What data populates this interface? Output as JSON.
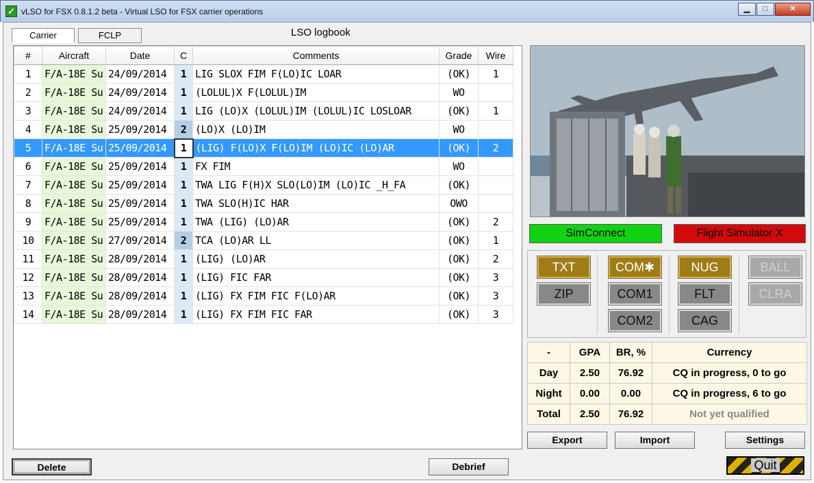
{
  "window": {
    "title": "vLSO for FSX 0.8.1.2 beta - Virtual LSO for FSX carrier operations",
    "min": "▁",
    "max": "□",
    "close": "✕"
  },
  "tabs": [
    {
      "label": "Carrier"
    },
    {
      "label": "FCLP"
    }
  ],
  "logbook_title": "LSO logbook",
  "grid": {
    "headers": {
      "num": "#",
      "aircraft": "Aircraft",
      "date": "Date",
      "c": "C",
      "comments": "Comments",
      "grade": "Grade",
      "wire": "Wire"
    },
    "rows": [
      {
        "num": "1",
        "aircraft": "F/A-18E Su",
        "date": "24/09/2014",
        "c": "1",
        "comments": "LIG SLOX FIM F(LO)IC LOAR",
        "grade": "(OK)",
        "wire": "1"
      },
      {
        "num": "2",
        "aircraft": "F/A-18E Su",
        "date": "24/09/2014",
        "c": "1",
        "comments": "(LOLUL)X F(LOLUL)IM",
        "grade": "WO",
        "wire": ""
      },
      {
        "num": "3",
        "aircraft": "F/A-18E Su",
        "date": "24/09/2014",
        "c": "1",
        "comments": "LIG (LO)X (LOLUL)IM (LOLUL)IC LOSLOAR",
        "grade": "(OK)",
        "wire": "1"
      },
      {
        "num": "4",
        "aircraft": "F/A-18E Su",
        "date": "25/09/2014",
        "c": "2",
        "comments": "(LO)X (LO)IM",
        "grade": "WO",
        "wire": ""
      },
      {
        "num": "5",
        "aircraft": "F/A-18E Su",
        "date": "25/09/2014",
        "c": "1",
        "comments": "(LIG) F(LO)X F(LO)IM (LO)IC (LO)AR",
        "grade": "(OK)",
        "wire": "2"
      },
      {
        "num": "6",
        "aircraft": "F/A-18E Su",
        "date": "25/09/2014",
        "c": "1",
        "comments": "FX FIM",
        "grade": "WO",
        "wire": ""
      },
      {
        "num": "7",
        "aircraft": "F/A-18E Su",
        "date": "25/09/2014",
        "c": "1",
        "comments": "TWA LIG F(H)X SLO(LO)IM (LO)IC _H_FA",
        "grade": "(OK)",
        "wire": ""
      },
      {
        "num": "8",
        "aircraft": "F/A-18E Su",
        "date": "25/09/2014",
        "c": "1",
        "comments": "TWA SLO(H)IC HAR",
        "grade": "OWO",
        "wire": ""
      },
      {
        "num": "9",
        "aircraft": "F/A-18E Su",
        "date": "25/09/2014",
        "c": "1",
        "comments": "TWA (LIG) (LO)AR",
        "grade": "(OK)",
        "wire": "2"
      },
      {
        "num": "10",
        "aircraft": "F/A-18E Su",
        "date": "27/09/2014",
        "c": "2",
        "comments": "TCA (LO)AR LL",
        "grade": "(OK)",
        "wire": "1"
      },
      {
        "num": "11",
        "aircraft": "F/A-18E Su",
        "date": "28/09/2014",
        "c": "1",
        "comments": "(LIG) (LO)AR",
        "grade": "(OK)",
        "wire": "2"
      },
      {
        "num": "12",
        "aircraft": "F/A-18E Su",
        "date": "28/09/2014",
        "c": "1",
        "comments": "(LIG) FIC FAR",
        "grade": "(OK)",
        "wire": "3"
      },
      {
        "num": "13",
        "aircraft": "F/A-18E Su",
        "date": "28/09/2014",
        "c": "1",
        "comments": "(LIG) FX FIM FIC F(LO)AR",
        "grade": "(OK)",
        "wire": "3"
      },
      {
        "num": "14",
        "aircraft": "F/A-18E Su",
        "date": "28/09/2014",
        "c": "1",
        "comments": "(LIG) FX FIM FIC FAR",
        "grade": "(OK)",
        "wire": "3"
      }
    ],
    "selected_row": 5
  },
  "status": {
    "simconnect": "SimConnect",
    "simconnect_color": "#11d311",
    "fsx": "Flight Simulator X",
    "fsx_color": "#d40a0a"
  },
  "panel": {
    "txt": "TXT",
    "zip": "ZIP",
    "com_star": "COM✱",
    "com1": "COM1",
    "com2": "COM2",
    "nug": "NUG",
    "flt": "FLT",
    "cag": "CAG",
    "ball": "BALL",
    "clra": "CLRA"
  },
  "stats": {
    "headers": {
      "dash": "-",
      "gpa": "GPA",
      "br": "BR, %",
      "currency": "Currency"
    },
    "rows": [
      {
        "label": "Day",
        "gpa": "2.50",
        "br": "76.92",
        "currency": "CQ in progress, 0 to go"
      },
      {
        "label": "Night",
        "gpa": "0.00",
        "br": "0.00",
        "currency": "CQ in progress, 6 to go"
      },
      {
        "label": "Total",
        "gpa": "2.50",
        "br": "76.92",
        "currency": "Not yet qualified"
      }
    ]
  },
  "buttons": {
    "export": "Export",
    "import": "Import",
    "settings": "Settings",
    "delete": "Delete",
    "debrief": "Debrief",
    "quit": "Quit"
  }
}
